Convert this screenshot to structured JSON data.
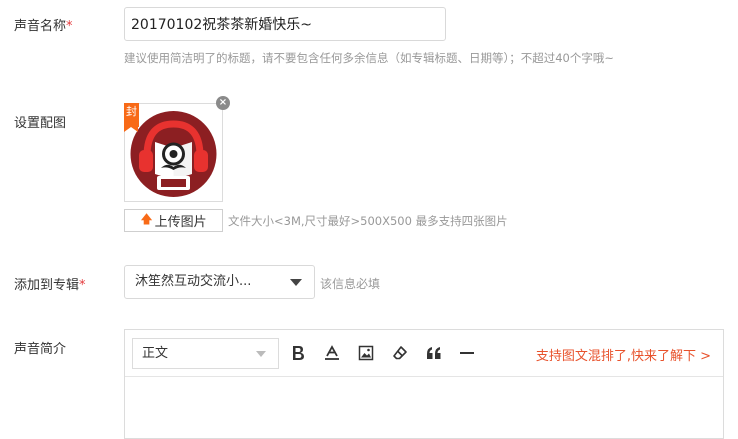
{
  "title_field": {
    "label": "声音名称",
    "required_mark": "*",
    "value": "20170102祝茶茶新婚快乐~",
    "hint": "建议使用简洁明了的标题，请不要包含任何多余信息（如专辑标题、日期等）；不超过40个字哦~"
  },
  "cover_field": {
    "label": "设置配图",
    "cover_tag": "封",
    "close_glyph": "×",
    "upload_label": "上传图片",
    "upload_hint": "文件大小<3M,尺寸最好>500X500 最多支持四张图片"
  },
  "album_field": {
    "label": "添加到专辑",
    "required_mark": "*",
    "selected": "沐笙然互动交流小...",
    "hint": "该信息必填"
  },
  "intro_field": {
    "label": "声音简介",
    "format_selected": "正文",
    "promo_text": "支持图文混排了,快来了解下 >"
  },
  "colors": {
    "accent": "#f86a17",
    "required": "#e4393c",
    "promo": "#e8522c"
  }
}
